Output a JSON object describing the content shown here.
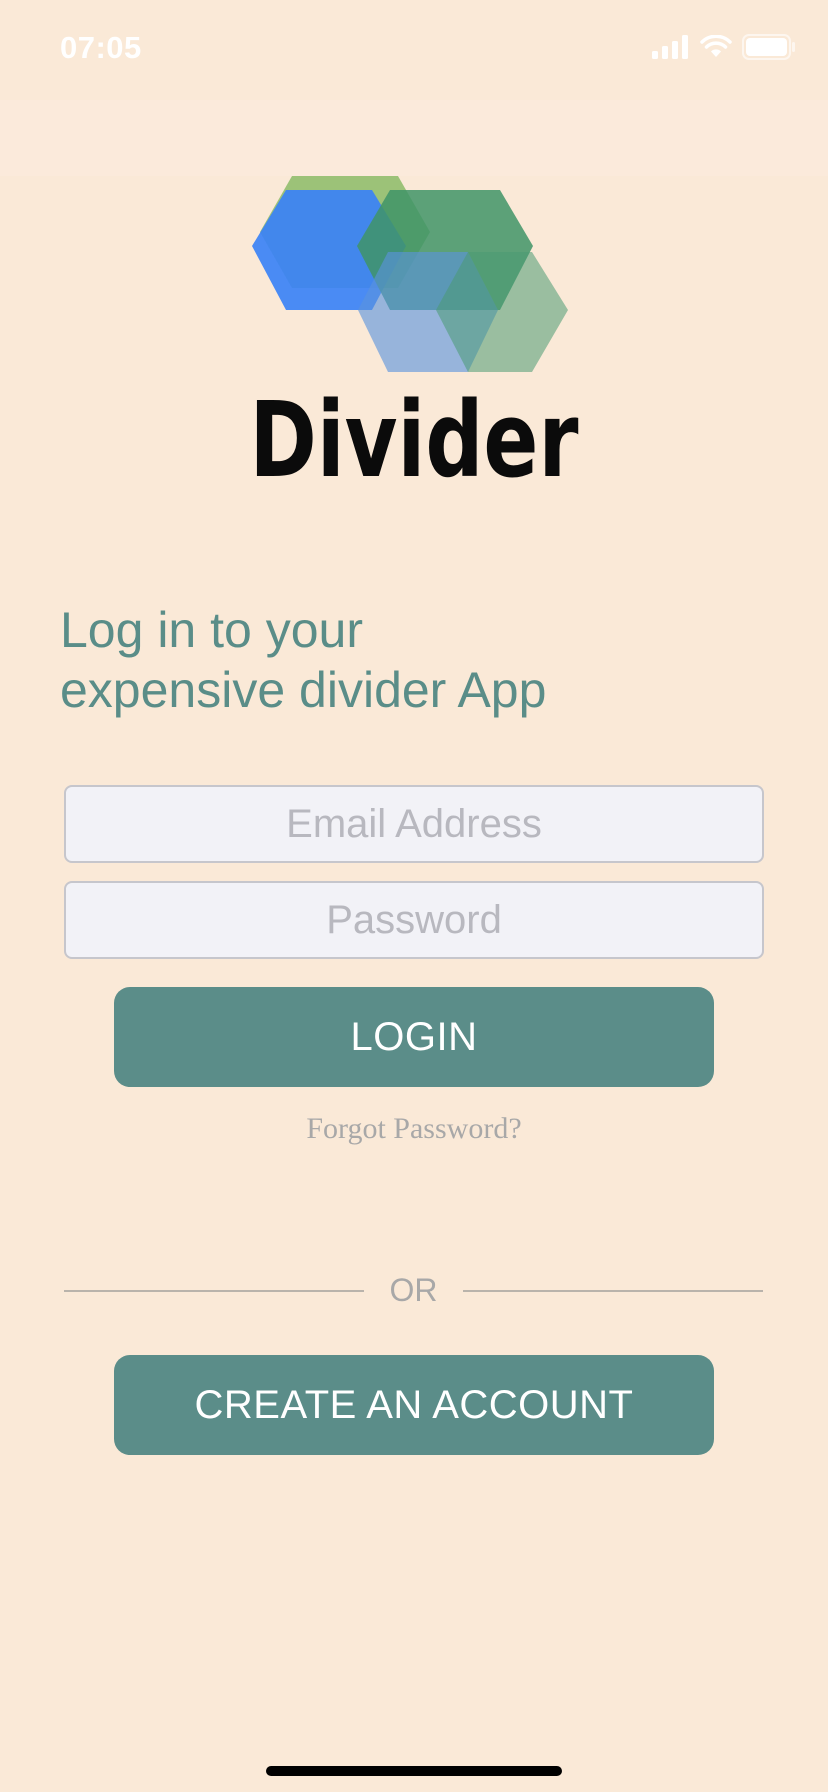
{
  "status_bar": {
    "time": "07:05",
    "signal_icon": "signal-bars-icon",
    "wifi_icon": "wifi-icon",
    "battery_icon": "battery-icon"
  },
  "brand": {
    "name": "Divider",
    "logo_icon": "hexagon-logo-icon",
    "colors": {
      "blue": "#3b82f6",
      "green_light": "#6aad45",
      "green_dark": "#4a9a72",
      "teal": "#5b8d89"
    }
  },
  "headline": {
    "line1": "Log in to your",
    "line2": "expensive divider App"
  },
  "form": {
    "email_placeholder": "Email Address",
    "email_value": "",
    "password_placeholder": "Password",
    "password_value": "",
    "login_label": "LOGIN",
    "forgot_label": "Forgot Password?"
  },
  "divider": {
    "label": "OR"
  },
  "signup": {
    "create_label": "CREATE AN ACCOUNT"
  },
  "theme": {
    "background": "#fae9d7",
    "accent": "#5b8d89",
    "input_bg": "#f2f2f7"
  }
}
